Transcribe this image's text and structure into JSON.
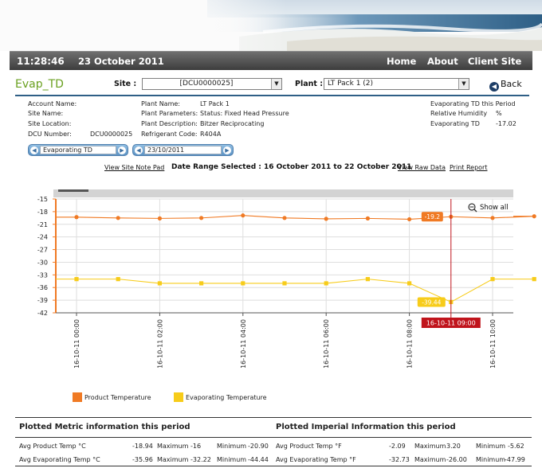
{
  "header": {
    "time": "11:28:46",
    "date": "23 October 2011",
    "nav": [
      "Home",
      "About",
      "Client Site"
    ]
  },
  "page": {
    "title": "Evap_TD",
    "site_label": "Site :",
    "site_value": "[DCU0000025]",
    "plant_label": "Plant :",
    "plant_value": "LT Pack 1 (2)",
    "back_label": "Back"
  },
  "info": {
    "col1": {
      "labels": [
        "Account Name:",
        "Site Name:",
        "Site Location:",
        "DCU Number:"
      ],
      "dcu_number": "DCU0000025"
    },
    "col2": {
      "labels": [
        "Plant Name:",
        "Plant Parameters:",
        "Plant Description:",
        "Refrigerant Code:"
      ],
      "values": [
        "LT Pack 1",
        "Status: Fixed Head Pressure",
        "Bitzer Reciprocating",
        "R404A"
      ]
    },
    "col3": {
      "heading": "Evaporating TD this Period",
      "rh_label": "Relative Humidity",
      "rh_value": "%",
      "evap_label": "Evaporating TD",
      "evap_value": "-17.02"
    }
  },
  "controls": {
    "parameter": "Evaporating TD",
    "date": "23/10/2011",
    "view_site_note": "View Site Note Pad",
    "range_text": "Date Range Selected :  16 October 2011 to 22 October 2011",
    "view_raw": "View Raw Data",
    "print_report": "Print Report",
    "show_all": "Show all"
  },
  "chart_data": {
    "type": "line",
    "ylim": [
      -42,
      -15
    ],
    "yticks": [
      -15,
      -18,
      -21,
      -24,
      -27,
      -30,
      -33,
      -36,
      -39,
      -42
    ],
    "x_hours": [
      0,
      0.5,
      1,
      1.5,
      2,
      2.5,
      3,
      3.5,
      4,
      4.5,
      5,
      5.5
    ],
    "x_tick_labels": [
      "16-10-11 00:00",
      "16-10-11 02:00",
      "16-10-11 04:00",
      "16-10-11 06:00",
      "16-10-11 08:00",
      "16-10-11 10:00"
    ],
    "series": [
      {
        "name": "Product Temperature",
        "color": "#f07a24",
        "values": [
          -19.3,
          -19.5,
          -19.6,
          -19.5,
          -18.9,
          -19.5,
          -19.7,
          -19.6,
          -19.8,
          -19.2,
          -19.5,
          -19.1
        ]
      },
      {
        "name": "Evaporating Temperature",
        "color": "#f7cc1a",
        "values": [
          -34.0,
          -34.0,
          -35.0,
          -35.0,
          -35.0,
          -35.0,
          -35.0,
          -34.0,
          -35.0,
          -39.44,
          -34.0,
          -34.0
        ]
      }
    ],
    "crosshair": {
      "x_label": "16-10-11 09:00",
      "product_value": "-19.2",
      "evap_value": "-39.44"
    }
  },
  "tables": {
    "metric": {
      "heading": "Plotted Metric information this period",
      "rows": [
        {
          "label": "Avg Product Temp °C",
          "avg": "-18.94",
          "max_label": "Maximum",
          "max": "-16",
          "min_label": "Minimum",
          "min": "-20.90"
        },
        {
          "label": "Avg Evaporating Temp °C",
          "avg": "-35.96",
          "max_label": "Maximum",
          "max": "-32.22",
          "min_label": "Minimum",
          "min": "-44.44"
        }
      ]
    },
    "imperial": {
      "heading": "Plotted Imperial Information this period",
      "rows": [
        {
          "label": "Avg Product Temp °F",
          "avg": "-2.09",
          "max_label": "Maximum",
          "max": "3.20",
          "min_label": "Minimum",
          "min": "-5.62"
        },
        {
          "label": "Avg Evaporating Temp °F",
          "avg": "-32.73",
          "max_label": "Maximum",
          "max": "-26.00",
          "min_label": "Minimum",
          "min": "-47.99"
        }
      ]
    }
  }
}
